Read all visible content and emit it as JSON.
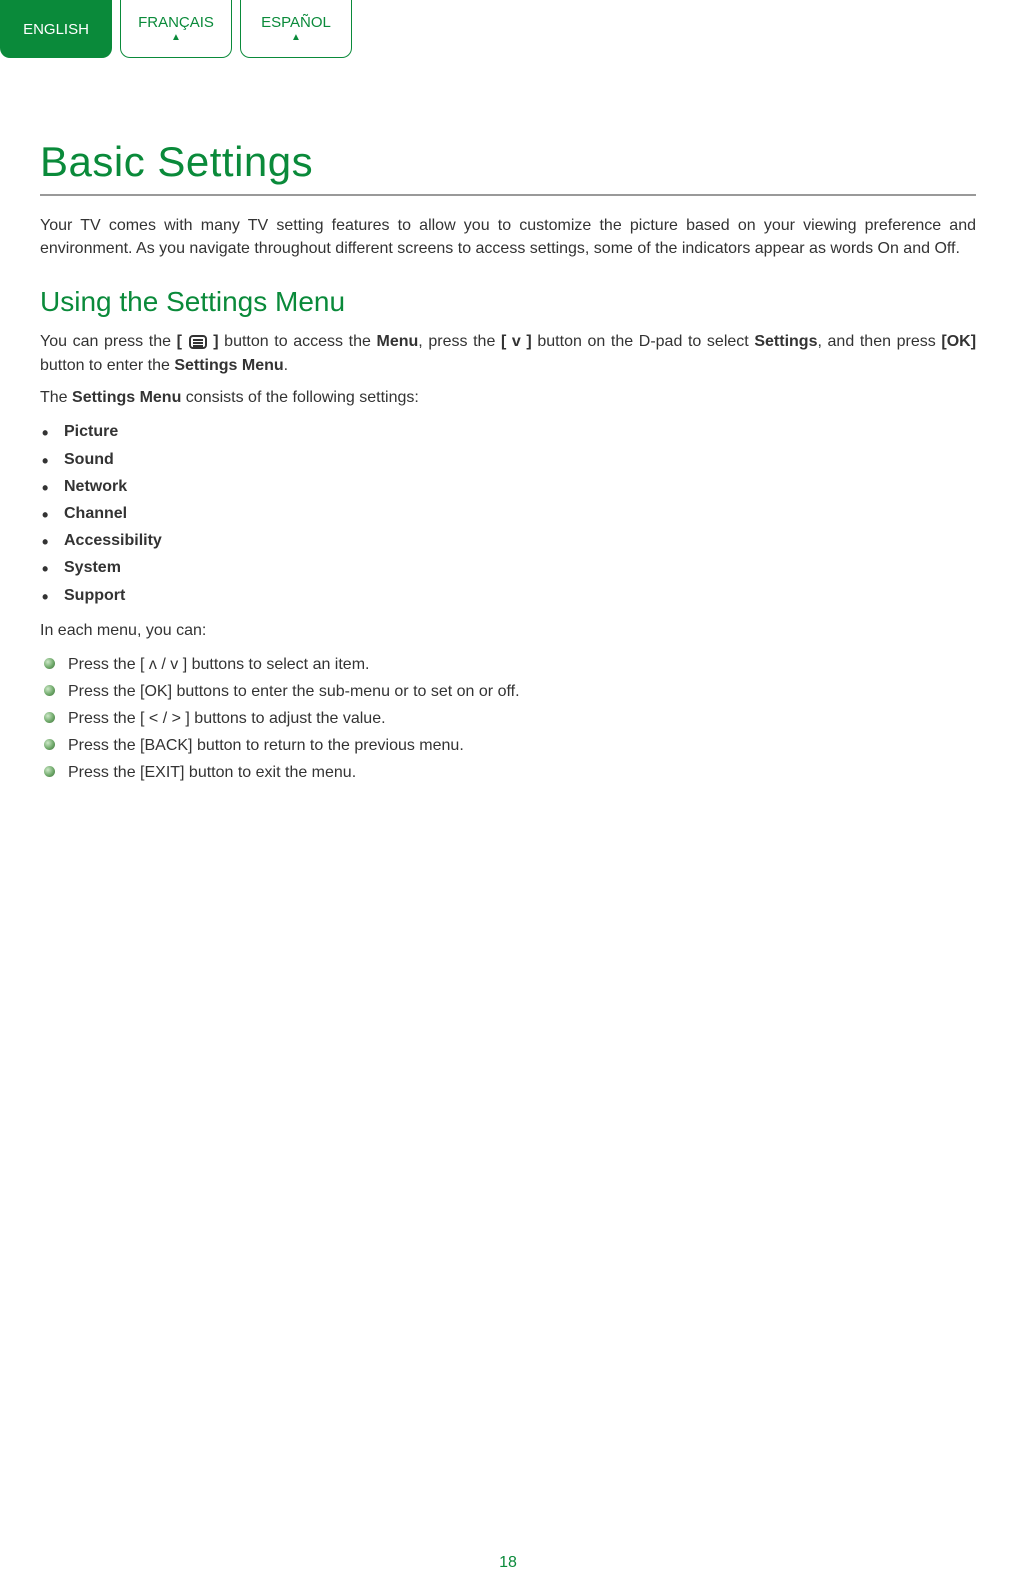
{
  "tabs": {
    "english": "ENGLISH",
    "francais": "FRANÇAIS",
    "espanol": "ESPAÑOL"
  },
  "title": "Basic Settings",
  "intro": "Your TV comes with many TV setting features to allow you to customize the picture based on your viewing preference and environment. As you navigate throughout different screens to access settings, some of the indicators appear as words On and Off.",
  "subtitle": "Using the Settings Menu",
  "access_para": {
    "prefix": "You can press the ",
    "bracket_open": "[ ",
    "bracket_close": " ]",
    "mid1": " button to access the ",
    "menu": "Menu",
    "mid2": ", press the ",
    "vbutton": "[ v ]",
    "mid3": " button on the D-pad to select ",
    "settings": "Settings",
    "mid4": ", and then press ",
    "ok": "[OK]",
    "mid5": " button to enter the ",
    "settings_menu": "Settings Menu",
    "end": "."
  },
  "consists_para": {
    "prefix": "The ",
    "settings_menu": "Settings Menu",
    "suffix": " consists of the following settings:"
  },
  "menu_items": [
    "Picture",
    "Sound",
    "Network",
    "Channel",
    "Accessibility",
    "System",
    "Support"
  ],
  "in_each": "In each menu, you can:",
  "actions": [
    {
      "pre": "Press the ",
      "bold": "[ ʌ / v ]",
      "post": " buttons to select an item."
    },
    {
      "pre": "Press the ",
      "bold": "[OK]",
      "post": " buttons to enter the sub-menu or to set on or off."
    },
    {
      "pre": "Press the ",
      "bold": "[ < / > ]",
      "post": " buttons to adjust the value."
    },
    {
      "pre": "Press the ",
      "bold": "[BACK]",
      "post": " button to return to the previous menu."
    },
    {
      "pre": "Press the ",
      "bold": "[EXIT]",
      "post": " button to exit the menu."
    }
  ],
  "page_number": "18"
}
